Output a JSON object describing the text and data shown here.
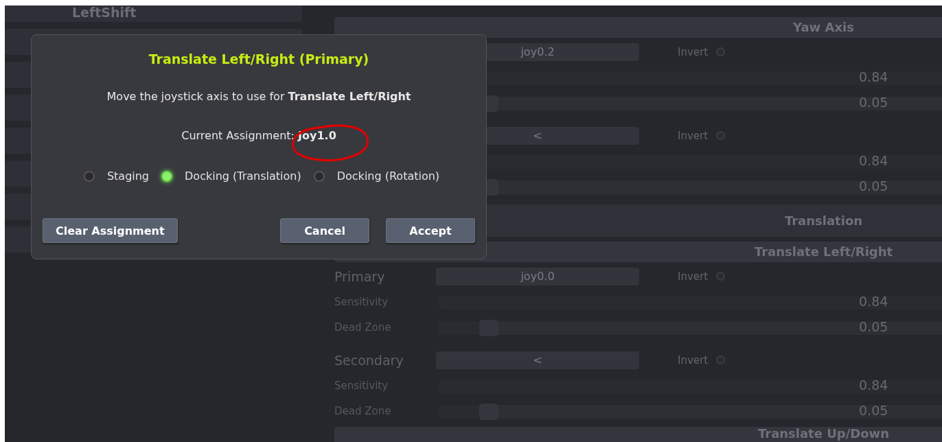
{
  "key_list": {
    "items": [
      {
        "label": "LeftShift"
      }
    ]
  },
  "axis_panel": {
    "rows": [
      {
        "kind": "subheader",
        "title": "Yaw Axis"
      },
      {
        "kind": "binding",
        "field": "joy0.2",
        "invert_label": "Invert",
        "inverted": false
      },
      {
        "kind": "slider",
        "value": "0.84",
        "level": 0.84
      },
      {
        "kind": "slider",
        "value": "0.05",
        "level": 0.05
      },
      {
        "kind": "binding",
        "field": "<",
        "invert_label": "Invert",
        "inverted": false
      },
      {
        "kind": "slider",
        "value": "0.84",
        "level": 0.84
      },
      {
        "kind": "slider",
        "value": "0.05",
        "level": 0.05
      },
      {
        "kind": "header",
        "title": "Translation"
      },
      {
        "kind": "subheader",
        "title": "Translate Left/Right"
      },
      {
        "kind": "binding",
        "label": "Primary",
        "field": "joy0.0",
        "invert_label": "Invert",
        "inverted": false
      },
      {
        "kind": "slider",
        "label": "Sensitivity",
        "value": "0.84",
        "level": 0.84
      },
      {
        "kind": "slider",
        "label": "Dead Zone",
        "value": "0.05",
        "level": 0.05
      },
      {
        "kind": "binding",
        "label": "Secondary",
        "field": "<",
        "invert_label": "Invert",
        "inverted": false
      },
      {
        "kind": "slider",
        "label": "Sensitivity",
        "value": "0.84",
        "level": 0.84
      },
      {
        "kind": "slider",
        "label": "Dead Zone",
        "value": "0.05",
        "level": 0.05
      },
      {
        "kind": "subheader",
        "title": "Translate Up/Down"
      }
    ]
  },
  "dialog": {
    "title": "Translate Left/Right (Primary)",
    "prompt": "Move the joystick axis to use for **Translate Left/Right**",
    "assignment": "Current Assignment: **Joy1.0**",
    "modes": [
      {
        "label": "Staging",
        "selected": false
      },
      {
        "label": "Docking (Translation)",
        "selected": true
      },
      {
        "label": "Docking (Rotation)",
        "selected": false
      }
    ],
    "buttons": [
      {
        "label": "Clear Assignment",
        "kind": "left"
      },
      {
        "label": "Cancel",
        "kind": "right"
      },
      {
        "label": "Accept",
        "kind": "right"
      }
    ],
    "annotation": {
      "kind": "circle"
    }
  }
}
